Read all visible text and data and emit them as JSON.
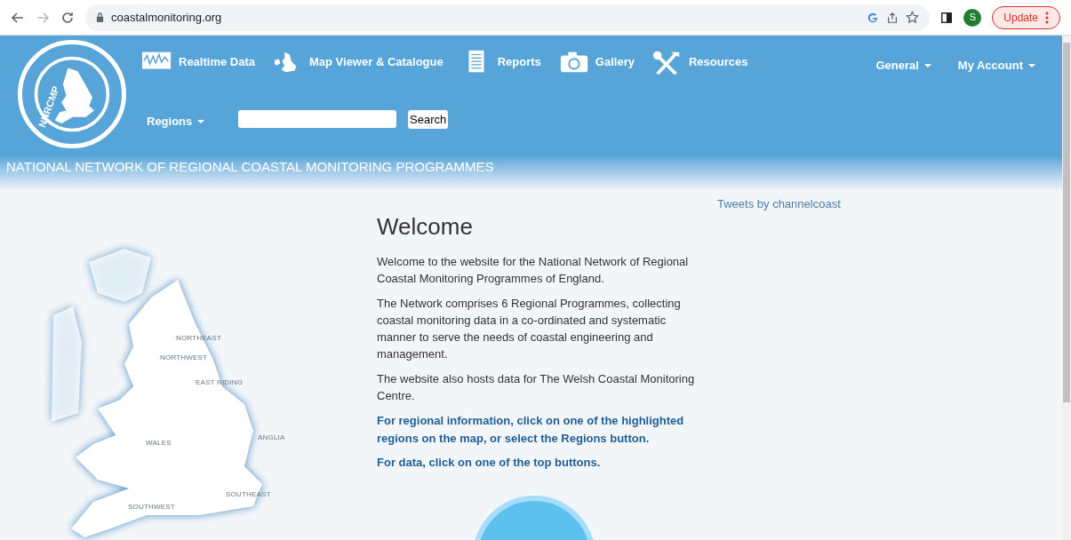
{
  "browser": {
    "url": "coastalmonitoring.org",
    "profile_initial": "S",
    "update_button": "Update"
  },
  "header": {
    "logo_text": "NNRCMP",
    "nav": [
      {
        "label": "Realtime Data",
        "kind": "wave"
      },
      {
        "label": "Map Viewer & Catalogue",
        "kind": "islands"
      },
      {
        "label": "Reports",
        "kind": "document"
      },
      {
        "label": "Gallery",
        "kind": "camera"
      },
      {
        "label": "Resources",
        "kind": "tools"
      }
    ],
    "menus": [
      {
        "label": "General"
      },
      {
        "label": "My Account"
      }
    ],
    "regions_menu": "Regions",
    "search_button": "Search",
    "banner": "NATIONAL NETWORK OF REGIONAL COASTAL MONITORING PROGRAMMES"
  },
  "map": {
    "labels": [
      "NORTHEAST",
      "NORTHWEST",
      "EAST RIDING",
      "WALES",
      "ANGLIA",
      "SOUTHWEST",
      "SOUTHEAST"
    ]
  },
  "content": {
    "title": "Welcome",
    "paragraphs": [
      {
        "text": "Welcome to the website for the National Network of Regional Coastal Monitoring Programmes of England.",
        "kind": "plain"
      },
      {
        "text": "The Network comprises 6 Regional Programmes, collecting coastal monitoring data in a co-ordinated and systematic manner to serve the needs of coastal engineering and management.",
        "kind": "plain"
      },
      {
        "text": "The website also hosts data for The Welsh Coastal Monitoring Centre.",
        "kind": "plain"
      },
      {
        "text": "For regional information, click on one of the highlighted regions on the map, or select the Regions button.",
        "kind": "emphasis"
      },
      {
        "text": "For data, click on one of the top buttons.",
        "kind": "emphasis"
      }
    ]
  },
  "sidebar": {
    "tweets_link": "Tweets by channelcoast"
  }
}
